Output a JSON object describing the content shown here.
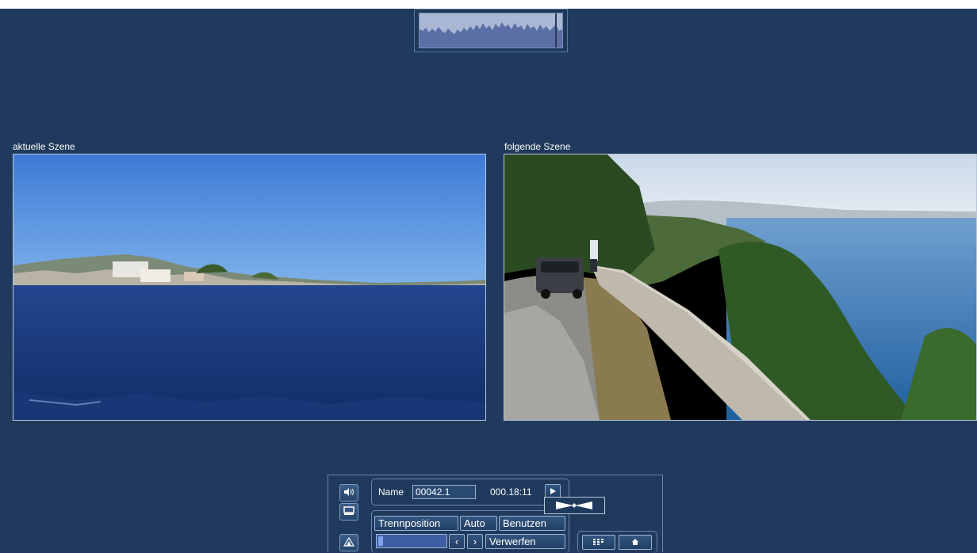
{
  "scenes": {
    "current_label": "aktuelle Szene",
    "next_label": "folgende Szene"
  },
  "controls": {
    "name_label": "Name",
    "name_value": "00042.1",
    "timecode": "000.18:11",
    "split_position_label": "Trennposition",
    "auto_label": "Auto",
    "use_label": "Benutzen",
    "discard_label": "Verwerfen",
    "prev_symbol": "‹",
    "next_symbol": "›",
    "split_position_level": 0.05
  },
  "icons": {
    "play": "play-icon",
    "volume": "speaker-icon",
    "storyboard": "storyboard-icon",
    "scene_split": "scene-split-icon",
    "split_marker": "split-marker-icon",
    "menu": "menu-grid-icon",
    "home": "home-icon"
  },
  "colors": {
    "background": "#1f3a5c",
    "panel_border": "#6b86ab",
    "slider_fill": "#3d5ea3"
  }
}
